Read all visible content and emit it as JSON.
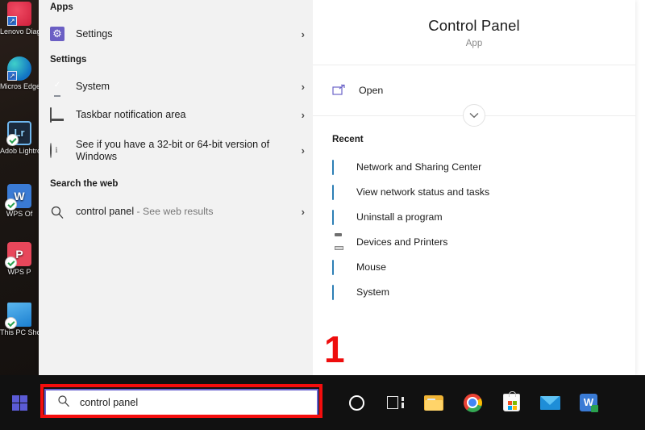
{
  "desktop": {
    "icons": [
      {
        "label": "Lenovo Diagno",
        "name": "lenovo-diagnostics-icon"
      },
      {
        "label": "Micros Edge",
        "name": "microsoft-edge-icon"
      },
      {
        "label": "Adob Lightro",
        "name": "adobe-lightroom-icon"
      },
      {
        "label": "WPS Of",
        "name": "wps-office-icon"
      },
      {
        "label": "WPS P",
        "name": "wps-presentation-icon"
      },
      {
        "label": "This PC Shortcu",
        "name": "this-pc-shortcut-icon"
      }
    ]
  },
  "flyout": {
    "left": {
      "apps_header": "Apps",
      "apps_items": [
        {
          "label": "Settings",
          "icon": "settings-gear-icon",
          "chevron": "›"
        }
      ],
      "settings_header": "Settings",
      "settings_items": [
        {
          "label": "System",
          "icon": "system-monitor-icon",
          "chevron": "›"
        },
        {
          "label": "Taskbar notification area",
          "icon": "taskbar-icon",
          "chevron": "›"
        },
        {
          "label": "See if you have a 32-bit or 64-bit version of Windows",
          "icon": "info-circle-icon",
          "chevron": "›"
        }
      ],
      "web_header": "Search the web",
      "web_items": [
        {
          "label": "control panel",
          "suffix": " - See web results",
          "icon": "search-icon",
          "chevron": "›"
        }
      ]
    },
    "right": {
      "app_title": "Control Panel",
      "app_subtitle": "App",
      "actions": [
        {
          "label": "Open",
          "icon": "open-window-icon"
        }
      ],
      "expander_icon": "chevron-down-icon",
      "recent_header": "Recent",
      "recent_items": [
        {
          "label": "Network and Sharing Center",
          "icon": "control-panel-item-icon"
        },
        {
          "label": "View network status and tasks",
          "icon": "control-panel-item-icon"
        },
        {
          "label": "Uninstall a program",
          "icon": "control-panel-item-icon"
        },
        {
          "label": "Devices and Printers",
          "icon": "printer-icon"
        },
        {
          "label": "Mouse",
          "icon": "control-panel-item-icon"
        },
        {
          "label": "System",
          "icon": "control-panel-item-icon"
        }
      ]
    }
  },
  "taskbar": {
    "start_icon": "windows-logo-icon",
    "search_value": "control panel",
    "search_icon": "search-icon",
    "icons": [
      {
        "name": "cortana-icon"
      },
      {
        "name": "task-view-icon"
      },
      {
        "name": "file-explorer-icon"
      },
      {
        "name": "google-chrome-icon"
      },
      {
        "name": "microsoft-store-icon"
      },
      {
        "name": "mail-icon"
      },
      {
        "name": "wps-writer-icon"
      }
    ]
  },
  "annotation": {
    "step_number": "1",
    "highlight_color": "#f40d0d"
  }
}
